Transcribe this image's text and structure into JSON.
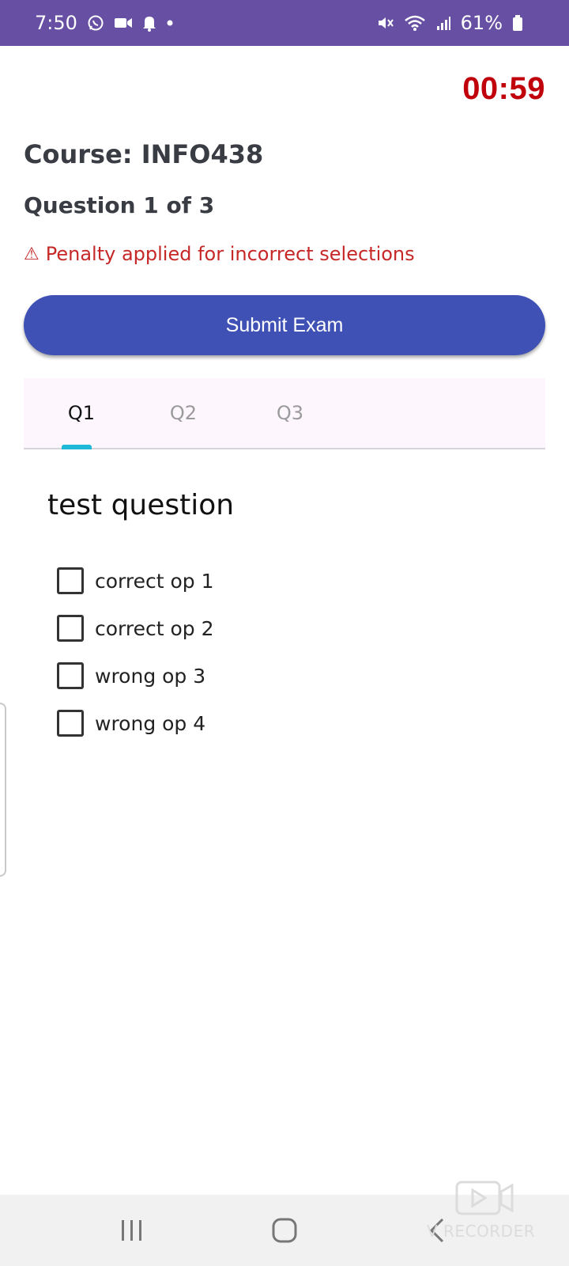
{
  "status_bar": {
    "time": "7:50",
    "battery": "61%",
    "icons": [
      "whatsapp-icon",
      "video-icon",
      "bell-icon",
      "dot-icon",
      "mute-icon",
      "wifi-icon",
      "signal-icon",
      "battery-icon"
    ],
    "color": "#6750a4"
  },
  "timer": {
    "value": "00:59",
    "color": "#c0000b"
  },
  "header": {
    "course": "Course: INFO438",
    "question_counter": "Question 1 of 3",
    "penalty_icon": "⚠",
    "penalty_text": "Penalty applied for incorrect selections"
  },
  "submit": {
    "label": "Submit Exam",
    "color": "#3f51b5"
  },
  "tabs": [
    {
      "label": "Q1",
      "active": true
    },
    {
      "label": "Q2",
      "active": false
    },
    {
      "label": "Q3",
      "active": false
    }
  ],
  "question": {
    "text": "test question",
    "options": [
      {
        "label": "correct op 1",
        "checked": false
      },
      {
        "label": "correct op 2",
        "checked": false
      },
      {
        "label": "wrong op 3",
        "checked": false
      },
      {
        "label": "wrong op 4",
        "checked": false
      }
    ]
  },
  "nav_bar": {
    "buttons": [
      "recents-icon",
      "home-icon",
      "back-icon"
    ]
  },
  "watermark": {
    "text": "V RECORDER"
  }
}
